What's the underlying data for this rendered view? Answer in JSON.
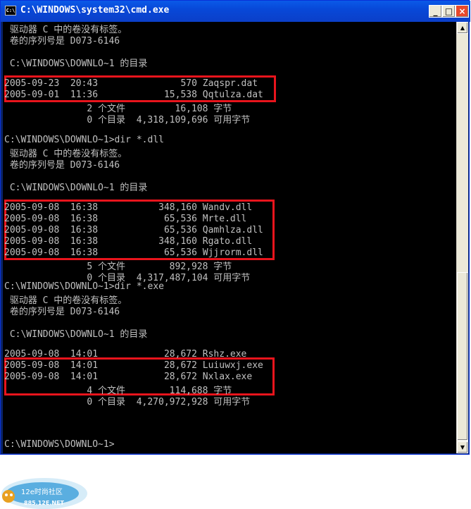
{
  "window": {
    "title": "C:\\WINDOWS\\system32\\cmd.exe",
    "icon_label": "C:\\",
    "minimize": "_",
    "maximize": "□",
    "close": "×"
  },
  "console": {
    "lines": [
      " 驱动器 C 中的卷没有标签。",
      " 卷的序列号是 D073-6146",
      "",
      " C:\\WINDOWS\\DOWNLO~1 的目录",
      "",
      "2005-09-23  20:43               570 Zaqspr.dat",
      "2005-09-01  11:36            15,538 Qqtulza.dat",
      "               2 个文件         16,108 字节",
      "               0 个目录  4,318,109,696 可用字节",
      "",
      "C:\\WINDOWS\\DOWNLO~1>dir *.dll",
      " 驱动器 C 中的卷没有标签。",
      " 卷的序列号是 D073-6146",
      "",
      " C:\\WINDOWS\\DOWNLO~1 的目录",
      "",
      "2005-09-08  16:38           348,160 Wandv.dll",
      "2005-09-08  16:38            65,536 Mrte.dll",
      "2005-09-08  16:38            65,536 Qamhlza.dll",
      "2005-09-08  16:38           348,160 Rgato.dll",
      "2005-09-08  16:38            65,536 Wjjrorm.dll",
      "               5 个文件        892,928 字节",
      "               0 个目录  4,317,487,104 可用字节",
      "C:\\WINDOWS\\DOWNLO~1>dir *.exe",
      " 驱动器 C 中的卷没有标签。",
      " 卷的序列号是 D073-6146",
      "",
      " C:\\WINDOWS\\DOWNLO~1 的目录",
      "",
      "2005-09-08  14:01            28,672 Rshz.exe",
      "2005-09-08  14:01            28,672 Luiuwxj.exe",
      "2005-09-08  14:01            28,672 Nxlax.exe",
      "               4 个文件        114,688 字节",
      "               0 个目录  4,270,972,928 可用字节",
      "",
      "",
      "",
      "C:\\WINDOWS\\DOWNLO~1>"
    ]
  },
  "scrollbar": {
    "up": "▲",
    "down": "▼"
  },
  "watermark": {
    "text": "12e时尚社区",
    "url": "885.12E.NET"
  },
  "colors": {
    "highlight": "#e8141c",
    "console_bg": "#000000",
    "console_fg": "#c0c0c0",
    "titlebar": "#0848d8"
  }
}
